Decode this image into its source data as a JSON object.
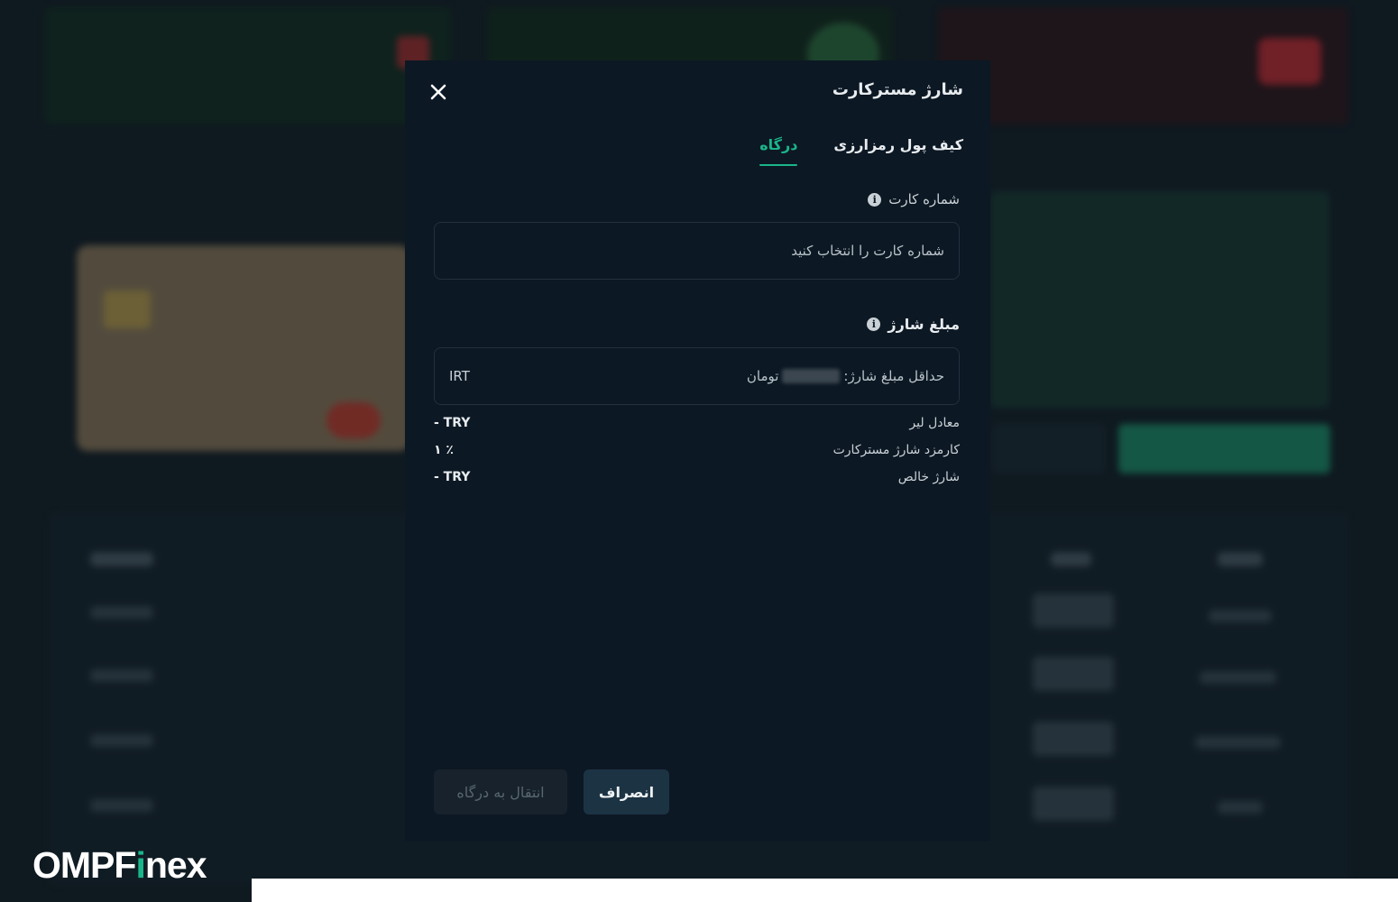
{
  "modal": {
    "title": "شارژ مسترکارت",
    "tabs": [
      {
        "label": "کیف پول رمزارزی",
        "active": false
      },
      {
        "label": "درگاه",
        "active": true
      }
    ],
    "card_number": {
      "label": "شماره کارت",
      "placeholder": "شماره کارت را انتخاب کنید"
    },
    "amount": {
      "label": "مبلغ شارژ",
      "prefix": "حداقل مبلغ شارژ:",
      "suffix": "تومان",
      "unit": "IRT"
    },
    "summary": [
      {
        "label": "معادل لیر",
        "value": "- TRY"
      },
      {
        "label": "کارمزد شارژ مسترکارت",
        "value": "۱ ٪"
      },
      {
        "label": "شارژ خالص",
        "value": "- TRY"
      }
    ],
    "buttons": {
      "cancel": "انصراف",
      "gateway": "انتقال به درگاه"
    }
  },
  "logo": {
    "part1": "OMPF",
    "part2": "i",
    "part3": "nex"
  },
  "colors": {
    "accent": "#1bb58a",
    "modal_bg": "#0c1824",
    "page_bg": "#0f1920"
  }
}
